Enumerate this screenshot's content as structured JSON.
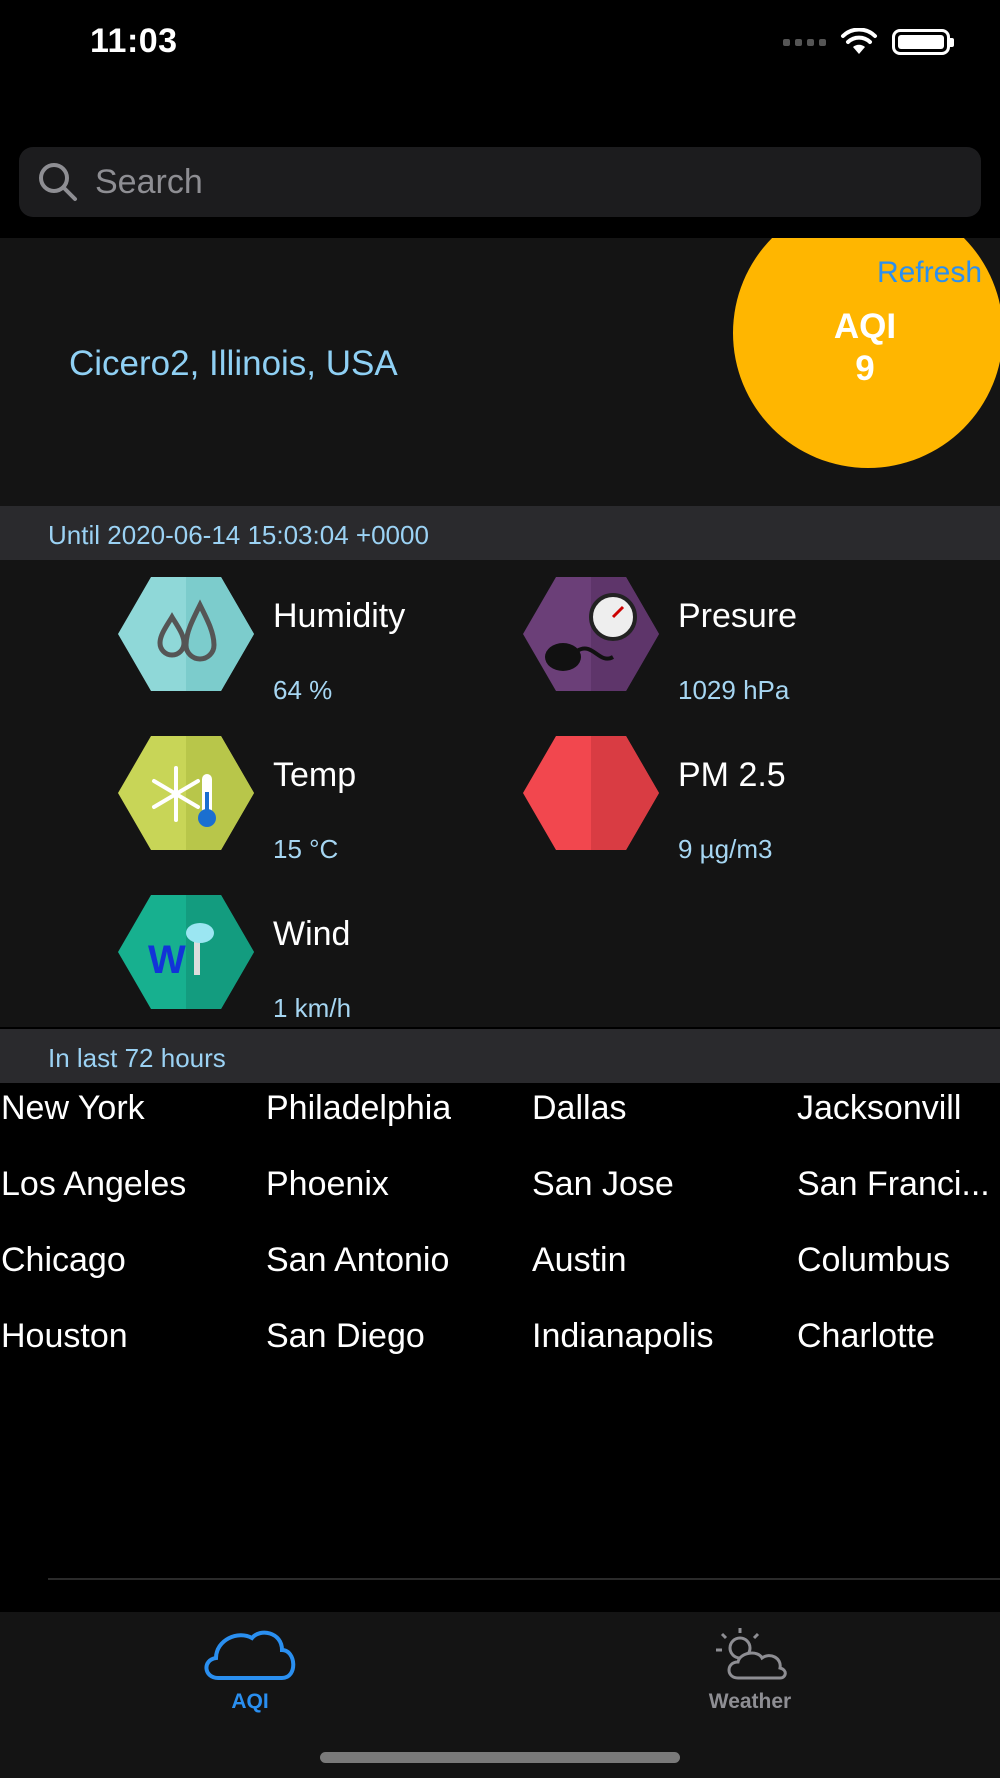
{
  "status": {
    "time": "11:03"
  },
  "search": {
    "placeholder": "Search"
  },
  "header": {
    "location": "Cicero2, Illinois, USA",
    "refresh_label": "Refresh",
    "aqi_label": "AQI",
    "aqi_value": "9",
    "aqi_color": "#ffb600"
  },
  "until": {
    "text": "Until 2020-06-14 15:03:04 +0000"
  },
  "metrics": [
    {
      "title": "Humidity",
      "value": "64 %",
      "icon": "humidity-icon"
    },
    {
      "title": "Presure",
      "value": "1029 hPa",
      "icon": "pressure-icon"
    },
    {
      "title": "Temp",
      "value": "15 °C",
      "icon": "temperature-icon"
    },
    {
      "title": "PM 2.5",
      "value": "9 µg/m3",
      "icon": "pm25-icon"
    },
    {
      "title": "Wind",
      "value": "1 km/h",
      "icon": "wind-icon"
    }
  ],
  "history": {
    "header": "In last 72 hours"
  },
  "cities": [
    [
      "New York",
      "Philadelphia",
      "Dallas",
      "Jacksonvill"
    ],
    [
      "Los Angeles",
      "Phoenix",
      "San Jose",
      "San Franci..."
    ],
    [
      "Chicago",
      "San Antonio",
      "Austin",
      "Columbus"
    ],
    [
      "Houston",
      "San Diego",
      "Indianapolis",
      "Charlotte"
    ]
  ],
  "tabs": [
    {
      "label": "AQI",
      "icon": "cloud-icon",
      "active": true
    },
    {
      "label": "Weather",
      "icon": "sun-cloud-icon",
      "active": false
    }
  ],
  "colors": {
    "accent": "#2a8ff0",
    "location": "#8fd0f4",
    "value": "#a6d6f2"
  }
}
